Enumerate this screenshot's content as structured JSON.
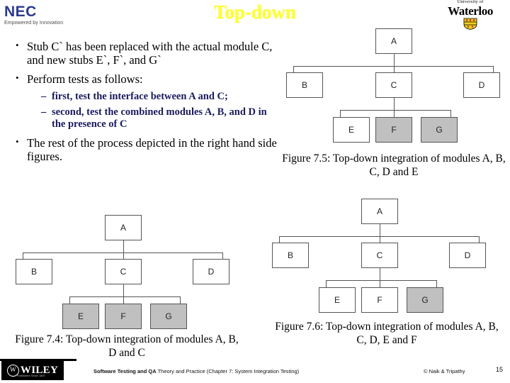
{
  "header": {
    "nec_logo": {
      "word": "NEC",
      "tagline": "Empowered by Innovation"
    },
    "waterloo_logo": {
      "line1": "University of",
      "line2": "Waterloo"
    },
    "title": "Top-down"
  },
  "body": {
    "bullet_marker": "•",
    "sub_marker": "–",
    "bullets": [
      {
        "text": "Stub C` has been replaced with the actual module C, and new stubs E`, F`, and G`"
      },
      {
        "text": "Perform tests as follows:"
      },
      {
        "text": "The rest of the process depicted in the right hand side figures."
      }
    ],
    "subbullets": [
      {
        "text": "first, test the interface between A and C;"
      },
      {
        "text": "second, test the combined modules A, B, and D in the presence of C"
      }
    ]
  },
  "diagrams": {
    "fig75": {
      "caption": "Figure 7.5: Top-down integration of modules A, B, C, D and E",
      "nodes": [
        {
          "id": "A",
          "label": "A",
          "shaded": false
        },
        {
          "id": "B",
          "label": "B",
          "shaded": false
        },
        {
          "id": "C",
          "label": "C",
          "shaded": false
        },
        {
          "id": "D",
          "label": "D",
          "shaded": false
        },
        {
          "id": "E",
          "label": "E",
          "shaded": false
        },
        {
          "id": "F",
          "label": "F",
          "shaded": true
        },
        {
          "id": "G",
          "label": "G",
          "shaded": true
        }
      ]
    },
    "fig74": {
      "caption": "Figure 7.4: Top-down integration of modules A, B, D and C",
      "nodes": [
        {
          "id": "A",
          "label": "A",
          "shaded": false
        },
        {
          "id": "B",
          "label": "B",
          "shaded": false
        },
        {
          "id": "C",
          "label": "C",
          "shaded": false
        },
        {
          "id": "D",
          "label": "D",
          "shaded": false
        },
        {
          "id": "E",
          "label": "E",
          "shaded": true
        },
        {
          "id": "F",
          "label": "F",
          "shaded": true
        },
        {
          "id": "G",
          "label": "G",
          "shaded": true
        }
      ]
    },
    "fig76": {
      "caption": "Figure 7.6: Top-down integration of modules A, B, C, D, E and F",
      "nodes": [
        {
          "id": "A",
          "label": "A",
          "shaded": false
        },
        {
          "id": "B",
          "label": "B",
          "shaded": false
        },
        {
          "id": "C",
          "label": "C",
          "shaded": false
        },
        {
          "id": "D",
          "label": "D",
          "shaded": false
        },
        {
          "id": "E",
          "label": "E",
          "shaded": false
        },
        {
          "id": "F",
          "label": "F",
          "shaded": false
        },
        {
          "id": "G",
          "label": "G",
          "shaded": true
        }
      ]
    }
  },
  "footer": {
    "wiley_word": "WILEY",
    "wiley_sub": "Publishers Since 1807",
    "center_bold": "Software Testing and QA",
    "center_rest": " Theory and Practice (Chapter 7: System Integration Testing)",
    "copyright": "© Naik & Tripathy",
    "page_number": "15"
  },
  "colors": {
    "title": "#ffff33",
    "subbullet": "#1a1a5e",
    "node_shade": "#c0c0c0",
    "nec_blue": "#2b3a8f"
  }
}
